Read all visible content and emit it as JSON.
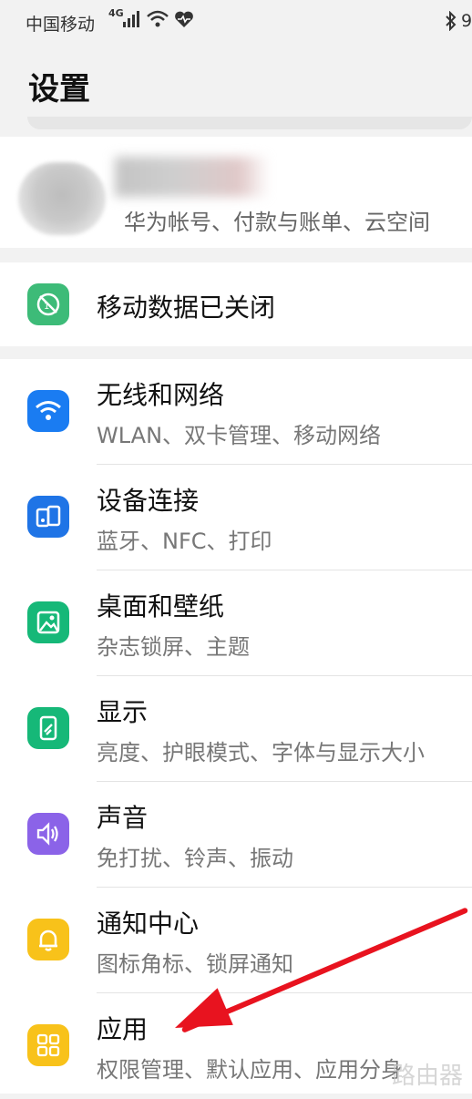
{
  "status_bar": {
    "carrier": "中国移动",
    "network": "4G",
    "right_text": "9"
  },
  "header": {
    "title": "设置"
  },
  "account": {
    "subtitle": "华为帐号、付款与账单、云空间"
  },
  "mobile_data": {
    "label": "移动数据已关闭"
  },
  "settings_items": [
    {
      "title": "无线和网络",
      "subtitle": "WLAN、双卡管理、移动网络",
      "icon": "wifi-icon",
      "color": "#1a7cf2"
    },
    {
      "title": "设备连接",
      "subtitle": "蓝牙、NFC、打印",
      "icon": "device-connection-icon",
      "color": "#1f74e6"
    },
    {
      "title": "桌面和壁纸",
      "subtitle": "杂志锁屏、主题",
      "icon": "wallpaper-icon",
      "color": "#16b878"
    },
    {
      "title": "显示",
      "subtitle": "亮度、护眼模式、字体与显示大小",
      "icon": "display-icon",
      "color": "#16b878"
    },
    {
      "title": "声音",
      "subtitle": "免打扰、铃声、振动",
      "icon": "sound-icon",
      "color": "#8b63e8"
    },
    {
      "title": "通知中心",
      "subtitle": "图标角标、锁屏通知",
      "icon": "bell-icon",
      "color": "#f8c21a"
    },
    {
      "title": "应用",
      "subtitle": "权限管理、默认应用、应用分身",
      "icon": "apps-grid-icon",
      "color": "#f8c21a"
    }
  ],
  "watermark": "路由器",
  "colors": {
    "annotation_arrow": "#e8131f",
    "mobile_data_icon": "#3dbb78"
  }
}
